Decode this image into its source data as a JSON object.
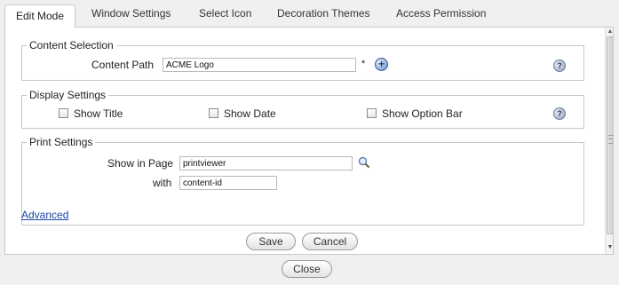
{
  "tabs": [
    {
      "label": "Edit Mode"
    },
    {
      "label": "Window Settings"
    },
    {
      "label": "Select Icon"
    },
    {
      "label": "Decoration Themes"
    },
    {
      "label": "Access Permission"
    }
  ],
  "active_tab": "Edit Mode",
  "content_selection": {
    "legend": "Content Selection",
    "path_label": "Content Path",
    "path_value": "ACME Logo",
    "required_mark": "*",
    "add_icon": "plus-circle-icon",
    "help_icon": "help-icon",
    "help_glyph": "?"
  },
  "display_settings": {
    "legend": "Display Settings",
    "show_title": {
      "label": "Show Title",
      "checked": false
    },
    "show_date": {
      "label": "Show Date",
      "checked": false
    },
    "show_option_bar": {
      "label": "Show Option Bar",
      "checked": false
    },
    "help_glyph": "?"
  },
  "print_settings": {
    "legend": "Print Settings",
    "page_label": "Show in Page",
    "page_value": "printviewer",
    "with_label": "with",
    "with_value": "content-id",
    "search_icon": "magnifier-icon"
  },
  "advanced_link": "Advanced",
  "buttons": {
    "save": "Save",
    "cancel": "Cancel",
    "close": "Close"
  },
  "scrollbar": {
    "up_arrow": "▲",
    "down_arrow": "▼"
  },
  "colors": {
    "link": "#1a45a8",
    "background": "#f0f0f0",
    "panel": "#ffffff",
    "border": "#c7c7c7"
  }
}
